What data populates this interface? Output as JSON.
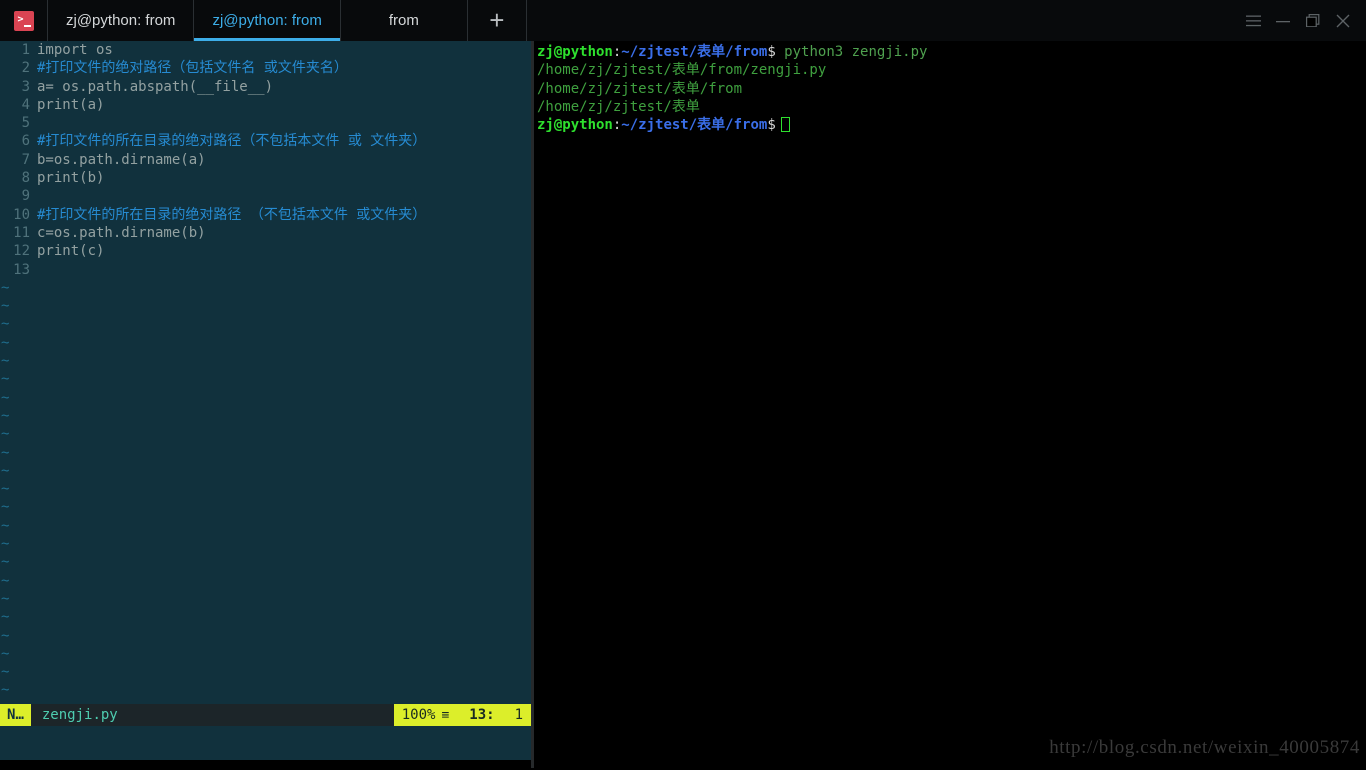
{
  "window": {
    "app_icon": "terminal-icon",
    "tabs": [
      {
        "label": "zj@python: from",
        "active": false
      },
      {
        "label": "zj@python: from",
        "active": true
      },
      {
        "label": "from",
        "active": false
      }
    ],
    "new_tab_label": "+",
    "controls": {
      "menu": "hamburger-menu-icon",
      "minimize": "minimize-icon",
      "maximize": "maximize-icon",
      "close": "close-icon"
    }
  },
  "editor": {
    "lines": [
      {
        "n": "1",
        "text": "import os",
        "comment": false
      },
      {
        "n": "2",
        "text": "#打印文件的绝对路径（包括文件名 或文件夹名）",
        "comment": true
      },
      {
        "n": "3",
        "text": "a= os.path.abspath(__file__)",
        "comment": false
      },
      {
        "n": "4",
        "text": "print(a)",
        "comment": false
      },
      {
        "n": "5",
        "text": "",
        "comment": false
      },
      {
        "n": "6",
        "text": "#打印文件的所在目录的绝对路径（不包括本文件 或 文件夹）",
        "comment": true
      },
      {
        "n": "7",
        "text": "b=os.path.dirname(a)",
        "comment": false
      },
      {
        "n": "8",
        "text": "print(b)",
        "comment": false
      },
      {
        "n": "9",
        "text": "",
        "comment": false
      },
      {
        "n": "10",
        "text": "#打印文件的所在目录的绝对路径 （不包括本文件 或文件夹）",
        "comment": true
      },
      {
        "n": "11",
        "text": "c=os.path.dirname(b)",
        "comment": false
      },
      {
        "n": "12",
        "text": "print(c)",
        "comment": false
      },
      {
        "n": "13",
        "text": "",
        "comment": false
      }
    ],
    "empty_marker": "~",
    "empty_marker_count": 24,
    "statusbar": {
      "mode": "N",
      "mode_suffix": "…",
      "filename": "zengji.py",
      "percent": "100%",
      "glyph": "≡",
      "line": "13:",
      "column": "1"
    }
  },
  "terminal": {
    "lines": [
      {
        "type": "prompt",
        "user": "zj@python",
        "colon": ":",
        "path": "~/zjtest/表单/from",
        "dollar": "$",
        "command": " python3 zengji.py",
        "cursor": false
      },
      {
        "type": "output",
        "text": "/home/zj/zjtest/表单/from/zengji.py"
      },
      {
        "type": "output",
        "text": "/home/zj/zjtest/表单/from"
      },
      {
        "type": "output",
        "text": "/home/zj/zjtest/表单"
      },
      {
        "type": "prompt",
        "user": "zj@python",
        "colon": ":",
        "path": "~/zjtest/表单/from",
        "dollar": "$",
        "command": "",
        "cursor": true
      }
    ]
  },
  "watermark": {
    "text": "http://blog.csdn.net/weixin_40005874"
  },
  "colors": {
    "editor_bg": "#11313d",
    "terminal_bg": "#000000",
    "accent_blue": "#3daee9",
    "status_yellow": "#dcee2a",
    "comment_blue": "#268bd2",
    "code_fg": "#93a1a1",
    "prompt_green": "#2ee02e",
    "prompt_blue": "#3a6ee8",
    "output_green": "#3fa03f"
  }
}
